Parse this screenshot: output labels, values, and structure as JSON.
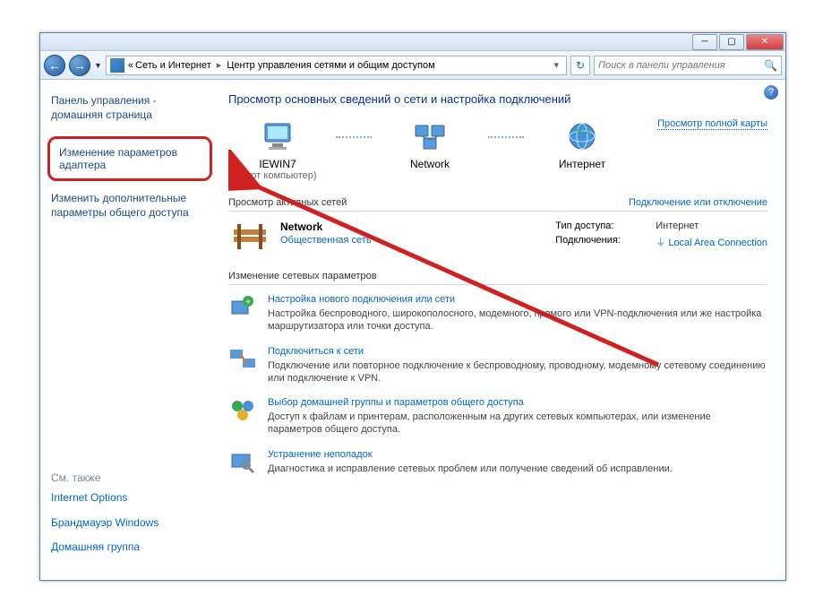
{
  "breadcrumb": {
    "prefix": "«",
    "parent": "Сеть и Интернет",
    "current": "Центр управления сетями и общим доступом"
  },
  "search": {
    "placeholder": "Поиск в панели управления"
  },
  "sidebar": {
    "cp_home": "Панель управления - домашняя страница",
    "highlighted": "Изменение параметров адаптера",
    "extra": "Изменить дополнительные параметры общего доступа",
    "see_also": "См. также",
    "footer": [
      "Internet Options",
      "Брандмауэр Windows",
      "Домашняя группа"
    ]
  },
  "content": {
    "title": "Просмотр основных сведений о сети и настройка подключений",
    "map": {
      "pc": "IEWIN7",
      "pc_sub": "(этот компьютер)",
      "network": "Network",
      "internet": "Интернет",
      "full_link": "Просмотр полной карты"
    },
    "active_section": {
      "label": "Просмотр активных сетей",
      "toggle": "Подключение или отключение",
      "net_name": "Network",
      "net_type": "Общественная сеть",
      "access_k": "Тип доступа:",
      "access_v": "Интернет",
      "conn_k": "Подключения:",
      "conn_v": "Local Area Connection"
    },
    "settings_section": "Изменение сетевых параметров",
    "settings": [
      {
        "title": "Настройка нового подключения или сети",
        "desc": "Настройка беспроводного, широкополосного, модемного, прямого или VPN-подключения или же настройка маршрутизатора или точки доступа."
      },
      {
        "title": "Подключиться к сети",
        "desc": "Подключение или повторное подключение к беспроводному, проводному, модемному сетевому соединению или подключение к VPN."
      },
      {
        "title": "Выбор домашней группы и параметров общего доступа",
        "desc": "Доступ к файлам и принтерам, расположенным на других сетевых компьютерах, или изменение параметров общего доступа."
      },
      {
        "title": "Устранение неполадок",
        "desc": "Диагностика и исправление сетевых проблем или получение сведений об исправлении."
      }
    ]
  }
}
